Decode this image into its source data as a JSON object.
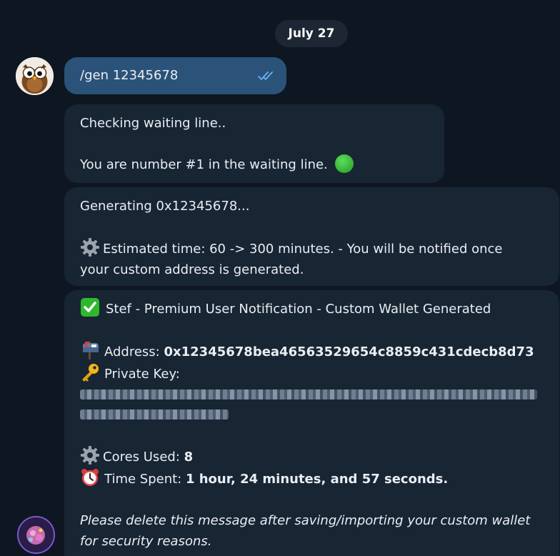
{
  "chat": {
    "date_label": "July 27",
    "outgoing": {
      "text": "/gen 12345678"
    },
    "msg1": {
      "line1": "Checking waiting line..",
      "line2": "You are number #1 in the waiting line."
    },
    "msg2": {
      "line1": "Generating 0x12345678...",
      "line2": "Estimated time: 60 -> 300 minutes. - You will be notified once",
      "line3": "your custom address is generated."
    },
    "msg3": {
      "title": "Stef -  Premium User Notification - Custom Wallet Generated",
      "address_label": "Address: ",
      "address_value": "0x12345678bea46563529654c8859c431cdecb8d73",
      "private_key_label": "Private Key:",
      "cores_label": "Cores Used: ",
      "cores_value": "8",
      "time_label": "Time Spent: ",
      "time_value": "1 hour, 24 minutes, and 57 seconds.",
      "note_line1": "Please delete this message after saving/importing your custom wallet",
      "note_line2": "for security reasons."
    }
  },
  "icons": {
    "status_dot": "green-circle-icon",
    "gear": "gear-icon",
    "check": "white-check-mark-icon",
    "mailbox": "mailbox-icon",
    "key": "key-icon",
    "clock": "alarm-clock-icon",
    "read": "double-check-icon"
  },
  "colors": {
    "background": "#0e1621",
    "bubble_in": "#182533",
    "bubble_out": "#2b5278",
    "accent_green": "#2eb82e"
  }
}
